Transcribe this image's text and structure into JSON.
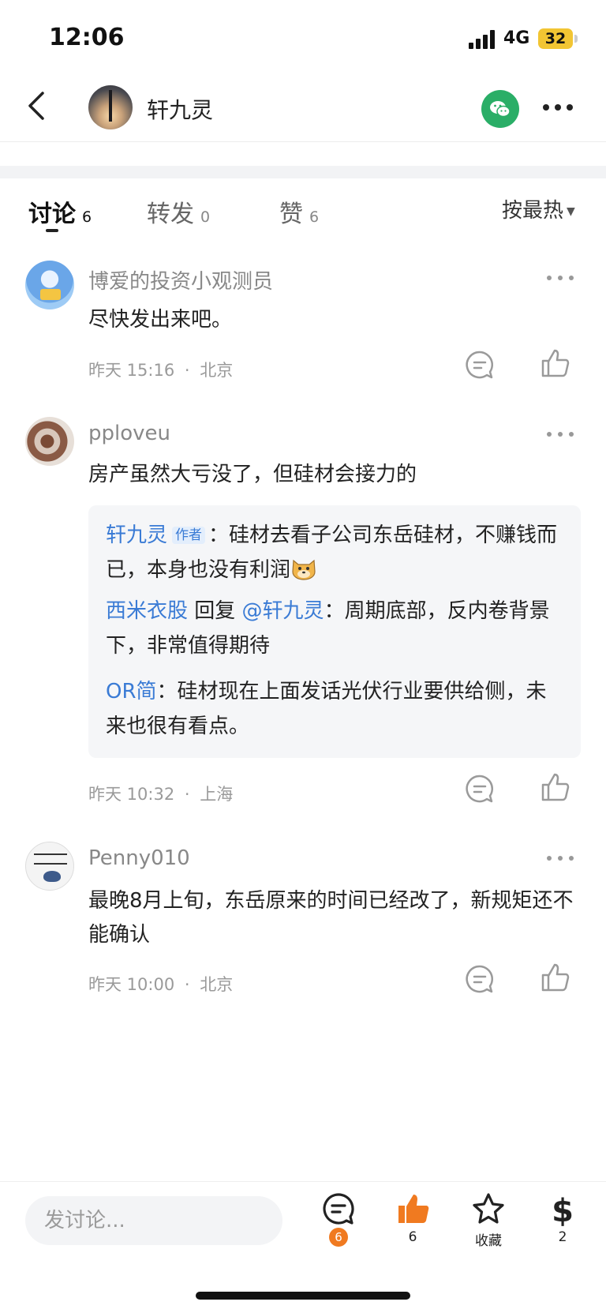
{
  "status_bar": {
    "time": "12:06",
    "network": "4G",
    "battery": "32"
  },
  "nav": {
    "title": "轩九灵"
  },
  "tabs": [
    {
      "label": "讨论",
      "count": "6"
    },
    {
      "label": "转发",
      "count": "0"
    },
    {
      "label": "赞",
      "count": "6"
    }
  ],
  "sort_label": "按最热",
  "comments": [
    {
      "username": "博爱的投资小观测员",
      "text": "尽快发出来吧。",
      "time": "昨天 15:16",
      "location": "北京"
    },
    {
      "username": "pploveu",
      "text": "房产虽然大亏没了，但硅材会接力的",
      "time": "昨天 10:32",
      "location": "上海",
      "replies": [
        {
          "user": "轩九灵",
          "tag": "作者",
          "sep": "：",
          "text": "硅材去看子公司东岳硅材，不赚钱而已，本身也没有利润"
        },
        {
          "user": "西米衣股",
          "middle": " 回复 ",
          "target": "@轩九灵",
          "sep": "：",
          "text": "周期底部，反内卷背景下，非常值得期待"
        },
        {
          "user": "OR简",
          "sep": "：",
          "text": "硅材现在上面发话光伏行业要供给侧，未来也很有看点。"
        }
      ]
    },
    {
      "username": "Penny010",
      "text": "最晚8月上旬，东岳原来的时间已经改了，新规矩还不能确认",
      "time": "昨天 10:00",
      "location": "北京"
    }
  ],
  "meta_separator": "·",
  "bottom_bar": {
    "input_placeholder": "发讨论...",
    "comment_count": "6",
    "like_count": "6",
    "favorite_label": "收藏",
    "reward_count": "2"
  },
  "colors": {
    "accent_blue": "#3a7bd5",
    "like_orange": "#f07a20",
    "wechat_green": "#2aae67"
  }
}
